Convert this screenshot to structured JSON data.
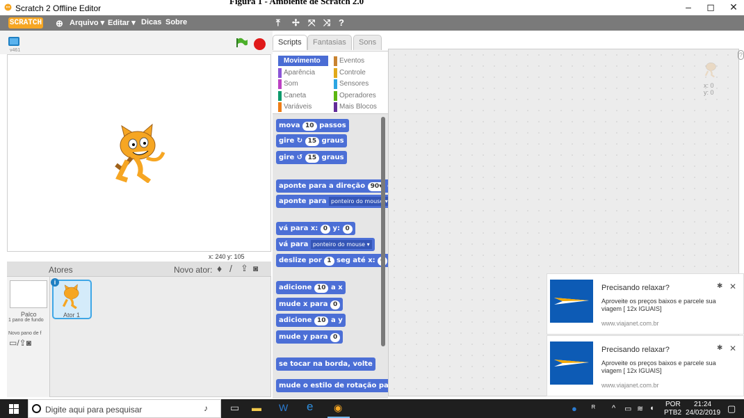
{
  "window": {
    "title": "Scratch 2 Offline Editor",
    "overlay_title": "Figura 1 - Ambiente de Scratch 2.0",
    "controls": [
      "–",
      "◻",
      "✕"
    ]
  },
  "menubar": {
    "logo": "SCRATCH",
    "items": [
      "Arquivo ▾",
      "Editar ▾",
      "Dicas",
      "Sobre"
    ],
    "tools": [
      "⤒",
      "✢",
      "⤧",
      "⤨",
      "?"
    ]
  },
  "stage": {
    "version": "v461",
    "coords": "x: 240  y: 105"
  },
  "sprites": {
    "header": "Atores",
    "new_sprite_label": "Novo ator:",
    "stage_label": "Palco",
    "stage_backdrops": "1 pano de fundo",
    "new_backdrop": "Novo pano de f",
    "sprite_name": "Ator 1"
  },
  "tabs": [
    "Scripts",
    "Fantasias",
    "Sons"
  ],
  "categories": [
    {
      "label": "Movimento",
      "color": "#4a6cd4",
      "active": true
    },
    {
      "label": "Eventos",
      "color": "#c88330"
    },
    {
      "label": "Aparência",
      "color": "#8a55d7"
    },
    {
      "label": "Controle",
      "color": "#e1a91a"
    },
    {
      "label": "Som",
      "color": "#bb42c3"
    },
    {
      "label": "Sensores",
      "color": "#2ca5e2"
    },
    {
      "label": "Caneta",
      "color": "#0e9a6c"
    },
    {
      "label": "Operadores",
      "color": "#5cb712"
    },
    {
      "label": "Variáveis",
      "color": "#ee7d16"
    },
    {
      "label": "Mais Blocos",
      "color": "#632d99"
    }
  ],
  "blocks": [
    {
      "pre": "mova",
      "num": "10",
      "post": "passos"
    },
    {
      "pre": "gire ↻",
      "num": "15",
      "post": "graus"
    },
    {
      "pre": "gire ↺",
      "num": "15",
      "post": "graus"
    },
    {
      "pre": "aponte para a direção",
      "num": "90▾",
      "post": "gra"
    },
    {
      "pre": "aponte para",
      "dd": "ponteiro do mouse ▾",
      "post": ""
    },
    {
      "pre": "vá para x:",
      "num": "0",
      "post": "y:",
      "num2": "0"
    },
    {
      "pre": "vá para",
      "dd": "ponteiro do mouse ▾",
      "post": ""
    },
    {
      "pre": "deslize por",
      "num": "1",
      "post": "seg até x:",
      "num2": "0",
      "post2": "y:"
    },
    {
      "pre": "adicione",
      "num": "10",
      "post": "a x"
    },
    {
      "pre": "mude x para",
      "num": "0",
      "post": ""
    },
    {
      "pre": "adicione",
      "num": "10",
      "post": "a y"
    },
    {
      "pre": "mude y para",
      "num": "0",
      "post": ""
    },
    {
      "pre": "se tocar na borda, volte",
      "post": ""
    },
    {
      "pre": "mude o estilo de rotação para",
      "post": ""
    }
  ],
  "scripts_area": {
    "x": "x: 0",
    "y": "y: 0",
    "help": "?"
  },
  "notifications": [
    {
      "title": "Precisando relaxar?",
      "body": "Aproveite os preços baixos e parcele sua viagem [ 12x IGUAIS]",
      "url": "www.viajanet.com.br"
    },
    {
      "title": "Precisando relaxar?",
      "body": "Aproveite os preços baixos e parcele sua viagem [ 12x IGUAIS]",
      "url": "www.viajanet.com.br"
    }
  ],
  "taskbar": {
    "search_placeholder": "Digite aqui para pesquisar",
    "lang": "POR",
    "layout": "PTB2",
    "time": "21:24",
    "date": "24/02/2019"
  },
  "colors": {
    "menubar": "#7a7a7a",
    "motion": "#4c6fd6",
    "toast_icon": "#0d5bb5",
    "taskbar": "#1f1f1f"
  }
}
